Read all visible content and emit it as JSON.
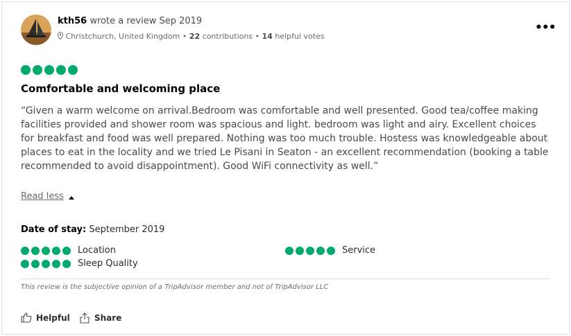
{
  "review": {
    "author": "kth56",
    "action_text": "wrote a review Sep 2019",
    "location": "Christchurch, United Kingdom",
    "contributions_count": "22",
    "contributions_label": "contributions",
    "helpful_count": "14",
    "helpful_label": "helpful votes",
    "rating": 5,
    "title": "Comfortable and welcoming place",
    "text": "“Given a warm welcome on arrival.Bedroom was comfortable and well presented. Good tea/coffee making facilities provided and shower room was spacious and light. bedroom was light and airy. Excellent choices for breakfast and food was well prepared. Nothing was too much trouble. Hostess was knowledgeable about places to eat in the locality and we tried Le Pisani in Seaton - an excellent recommendation (booking a table recommended to avoid disappointment). Good WiFi connectivity as well.”",
    "read_less": "Read less",
    "date_of_stay_label": "Date of stay:",
    "date_of_stay": "September 2019",
    "sub_ratings": [
      {
        "label": "Location",
        "rating": 5
      },
      {
        "label": "Service",
        "rating": 5
      },
      {
        "label": "Sleep Quality",
        "rating": 5
      }
    ],
    "disclaimer": "This review is the subjective opinion of a TripAdvisor member and not of TripAdvisor LLC",
    "actions": {
      "helpful": "Helpful",
      "share": "Share"
    }
  },
  "icons": {
    "more": "more-options-icon",
    "location": "map-pin-icon",
    "helpful": "thumbs-up-icon",
    "share": "share-icon"
  },
  "colors": {
    "bubble": "#00aa6c"
  }
}
